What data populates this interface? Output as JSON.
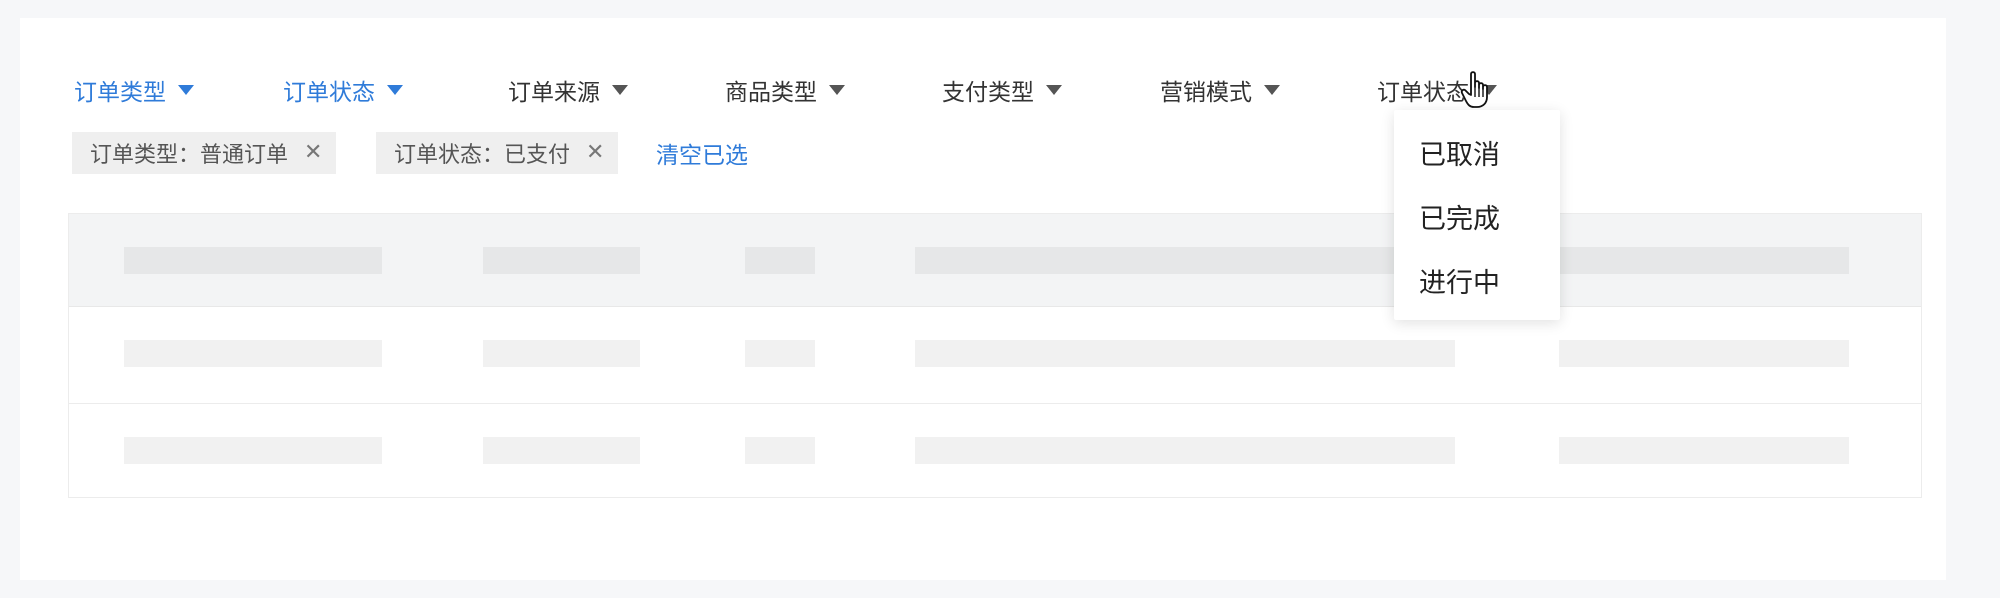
{
  "filters": [
    {
      "label": "订单类型",
      "active": true
    },
    {
      "label": "订单状态",
      "active": true
    },
    {
      "label": "订单来源",
      "active": false
    },
    {
      "label": "商品类型",
      "active": false
    },
    {
      "label": "支付类型",
      "active": false
    },
    {
      "label": "营销模式",
      "active": false
    },
    {
      "label": "订单状态",
      "active": false
    }
  ],
  "chips": [
    {
      "label": "订单类型：普通订单",
      "remove_icon": "close-icon"
    },
    {
      "label": "订单状态：已支付",
      "remove_icon": "close-icon"
    }
  ],
  "clear_label": "清空已选",
  "dropdown": {
    "options": [
      "已取消",
      "已完成",
      "进行中"
    ]
  },
  "colors": {
    "accent": "#2f7bd9",
    "text": "#333333",
    "chip_bg": "#efefef",
    "page_bg": "#f6f7f9"
  },
  "icons": {
    "caret": "caret-down-icon",
    "chip_remove": "close-icon",
    "cursor": "hand-pointer-icon"
  }
}
